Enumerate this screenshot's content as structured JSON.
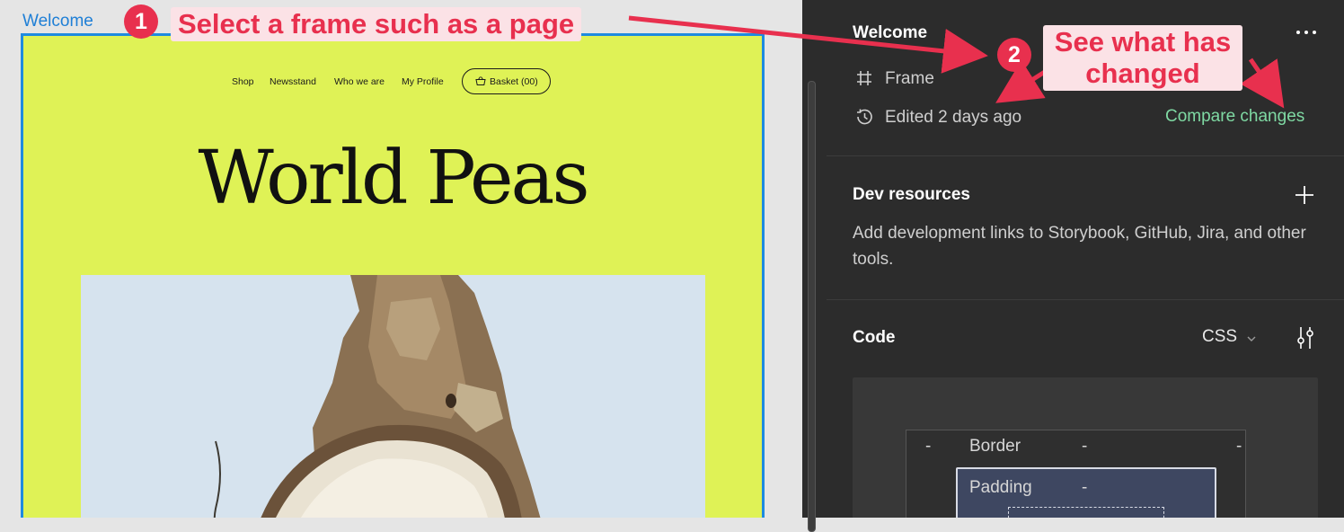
{
  "canvas": {
    "frame_label": "Welcome",
    "site": {
      "nav": [
        "Shop",
        "Newsstand",
        "Who we are",
        "My Profile"
      ],
      "basket_label": "Basket",
      "basket_count": "(00)",
      "title": "World Peas"
    }
  },
  "inspector": {
    "title": "Welcome",
    "node_type": "Frame",
    "edited": "Edited 2 days ago",
    "compare_link": "Compare changes",
    "dev_resources": {
      "title": "Dev resources",
      "description": "Add development links to Storybook, GitHub, Jira, and other tools."
    },
    "code": {
      "title": "Code",
      "language": "CSS",
      "box_model": {
        "border_label": "Border",
        "border_values": [
          "-",
          "-",
          "-"
        ],
        "padding_label": "Padding",
        "padding_value": "-"
      }
    }
  },
  "annotations": {
    "step1_number": "1",
    "step1_text": "Select a frame  such as a page",
    "step2_number": "2",
    "step2_text": "See what has changed",
    "color": "#e8304e"
  },
  "icons": {
    "frame": "hash-icon",
    "edited": "history-icon",
    "more": "more-dots-icon",
    "add": "plus-icon",
    "code_settings": "sliders-icon",
    "basket": "basket-icon"
  },
  "colors": {
    "selection": "#1e8be0",
    "frame_bg": "#dff256",
    "panel_bg": "#2c2c2c",
    "link_green": "#7fd9a3"
  }
}
